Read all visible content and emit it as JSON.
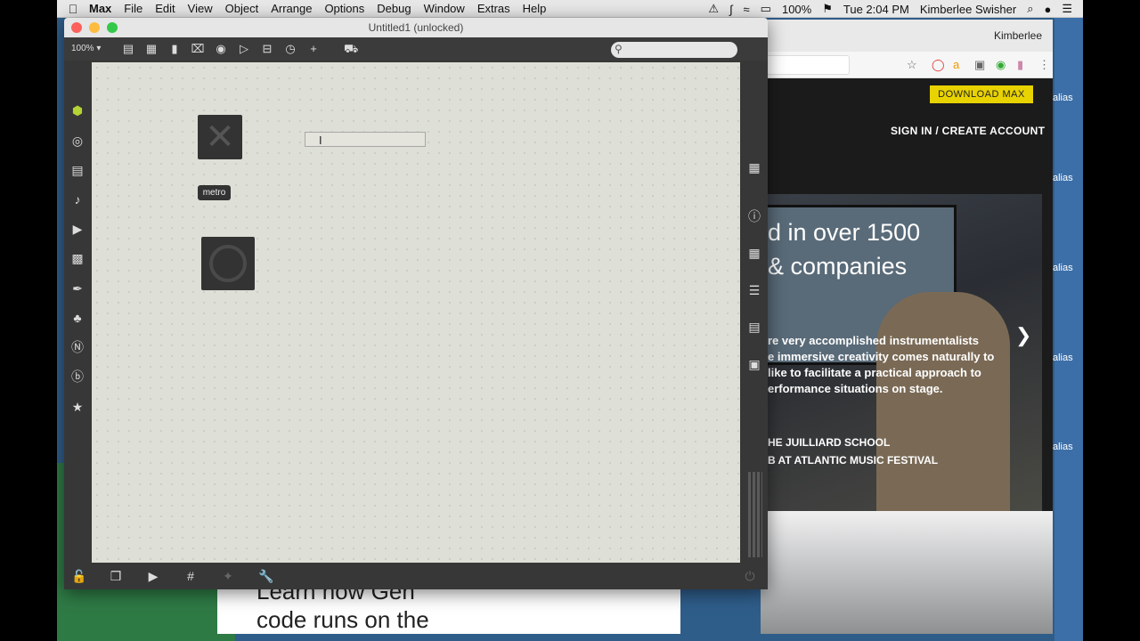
{
  "menubar": {
    "app": "Max",
    "items": [
      "File",
      "Edit",
      "View",
      "Object",
      "Arrange",
      "Options",
      "Debug",
      "Window",
      "Extras",
      "Help"
    ],
    "battery": "100%",
    "clock": "Tue 2:04 PM",
    "user": "Kimberlee Swisher"
  },
  "max_window": {
    "title": "Untitled1 (unlocked)",
    "zoom": "100%",
    "objects": {
      "metro_label": "metro"
    }
  },
  "browser": {
    "profile": "Kimberlee",
    "site": {
      "download_button": "DOWNLOAD MAX",
      "signin": "SIGN IN / CREATE ACCOUNT",
      "hero_line1": "d in over 1500",
      "hero_line2": "& companies",
      "hero_p1": "re very accomplished instrumentalists",
      "hero_p2": "e immersive creativity comes naturally to",
      "hero_p3": "like to facilitate a practical approach to",
      "hero_p4": "erformance situations on stage.",
      "credit1": "HE JUILLIARD SCHOOL",
      "credit2": "B AT ATLANTIC MUSIC FESTIVAL"
    },
    "below_line1": "Learn how Gen",
    "below_line2": "code runs on the"
  },
  "desktop": {
    "alias_labels": [
      "alias",
      "alias",
      "alias",
      "alias",
      "alias"
    ]
  },
  "colors": {
    "download_button": "#e8d200",
    "canvas": "#dedfd6",
    "patcher_chrome": "#373737"
  }
}
